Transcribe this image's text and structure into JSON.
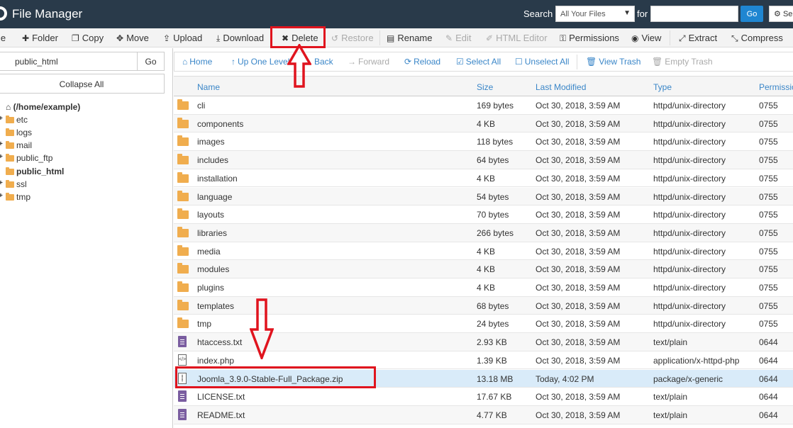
{
  "header": {
    "title": "File Manager",
    "search_label": "Search",
    "search_scope": "All Your Files",
    "for_label": "for",
    "search_placeholder": "",
    "go_label": "Go",
    "settings_label": "Se"
  },
  "toolbar": {
    "file_label": "le",
    "folder_label": "Folder",
    "copy_label": "Copy",
    "move_label": "Move",
    "upload_label": "Upload",
    "download_label": "Download",
    "delete_label": "Delete",
    "restore_label": "Restore",
    "rename_label": "Rename",
    "edit_label": "Edit",
    "html_editor_label": "HTML Editor",
    "permissions_label": "Permissions",
    "view_label": "View",
    "extract_label": "Extract",
    "compress_label": "Compress"
  },
  "sidebar": {
    "path_value": "public_html",
    "go_label": "Go",
    "collapse_label": "Collapse All",
    "root_label": "(/home/example)",
    "items": [
      {
        "label": "etc"
      },
      {
        "label": "logs"
      },
      {
        "label": "mail"
      },
      {
        "label": "public_ftp"
      },
      {
        "label": "public_html"
      },
      {
        "label": "ssl"
      },
      {
        "label": "tmp"
      }
    ]
  },
  "navbar": {
    "home": "Home",
    "up": "Up One Level",
    "back": "Back",
    "forward": "Forward",
    "reload": "Reload",
    "select_all": "Select All",
    "unselect_all": "Unselect All",
    "view_trash": "View Trash",
    "empty_trash": "Empty Trash"
  },
  "table": {
    "headers": {
      "name": "Name",
      "size": "Size",
      "modified": "Last Modified",
      "type": "Type",
      "perms": "Permissio"
    },
    "rows": [
      {
        "name": "cli",
        "size": "169 bytes",
        "modified": "Oct 30, 2018, 3:59 AM",
        "type": "httpd/unix-directory",
        "perms": "0755"
      },
      {
        "name": "components",
        "size": "4 KB",
        "modified": "Oct 30, 2018, 3:59 AM",
        "type": "httpd/unix-directory",
        "perms": "0755"
      },
      {
        "name": "images",
        "size": "118 bytes",
        "modified": "Oct 30, 2018, 3:59 AM",
        "type": "httpd/unix-directory",
        "perms": "0755"
      },
      {
        "name": "includes",
        "size": "64 bytes",
        "modified": "Oct 30, 2018, 3:59 AM",
        "type": "httpd/unix-directory",
        "perms": "0755"
      },
      {
        "name": "installation",
        "size": "4 KB",
        "modified": "Oct 30, 2018, 3:59 AM",
        "type": "httpd/unix-directory",
        "perms": "0755"
      },
      {
        "name": "language",
        "size": "54 bytes",
        "modified": "Oct 30, 2018, 3:59 AM",
        "type": "httpd/unix-directory",
        "perms": "0755"
      },
      {
        "name": "layouts",
        "size": "70 bytes",
        "modified": "Oct 30, 2018, 3:59 AM",
        "type": "httpd/unix-directory",
        "perms": "0755"
      },
      {
        "name": "libraries",
        "size": "266 bytes",
        "modified": "Oct 30, 2018, 3:59 AM",
        "type": "httpd/unix-directory",
        "perms": "0755"
      },
      {
        "name": "media",
        "size": "4 KB",
        "modified": "Oct 30, 2018, 3:59 AM",
        "type": "httpd/unix-directory",
        "perms": "0755"
      },
      {
        "name": "modules",
        "size": "4 KB",
        "modified": "Oct 30, 2018, 3:59 AM",
        "type": "httpd/unix-directory",
        "perms": "0755"
      },
      {
        "name": "plugins",
        "size": "4 KB",
        "modified": "Oct 30, 2018, 3:59 AM",
        "type": "httpd/unix-directory",
        "perms": "0755"
      },
      {
        "name": "templates",
        "size": "68 bytes",
        "modified": "Oct 30, 2018, 3:59 AM",
        "type": "httpd/unix-directory",
        "perms": "0755"
      },
      {
        "name": "tmp",
        "size": "24 bytes",
        "modified": "Oct 30, 2018, 3:59 AM",
        "type": "httpd/unix-directory",
        "perms": "0755"
      },
      {
        "name": "htaccess.txt",
        "size": "2.93 KB",
        "modified": "Oct 30, 2018, 3:59 AM",
        "type": "text/plain",
        "perms": "0644"
      },
      {
        "name": "index.php",
        "size": "1.39 KB",
        "modified": "Oct 30, 2018, 3:59 AM",
        "type": "application/x-httpd-php",
        "perms": "0644"
      },
      {
        "name": "Joomla_3.9.0-Stable-Full_Package.zip",
        "size": "13.18 MB",
        "modified": "Today, 4:02 PM",
        "type": "package/x-generic",
        "perms": "0644"
      },
      {
        "name": "LICENSE.txt",
        "size": "17.67 KB",
        "modified": "Oct 30, 2018, 3:59 AM",
        "type": "text/plain",
        "perms": "0644"
      },
      {
        "name": "README.txt",
        "size": "4.77 KB",
        "modified": "Oct 30, 2018, 3:59 AM",
        "type": "text/plain",
        "perms": "0644"
      }
    ]
  },
  "colors": {
    "header_bg": "#293a4a",
    "link_blue": "#3a86c8",
    "folder_orange": "#f0ad4e",
    "annotation_red": "#e0141e",
    "selected_row": "#d9ebf9"
  }
}
